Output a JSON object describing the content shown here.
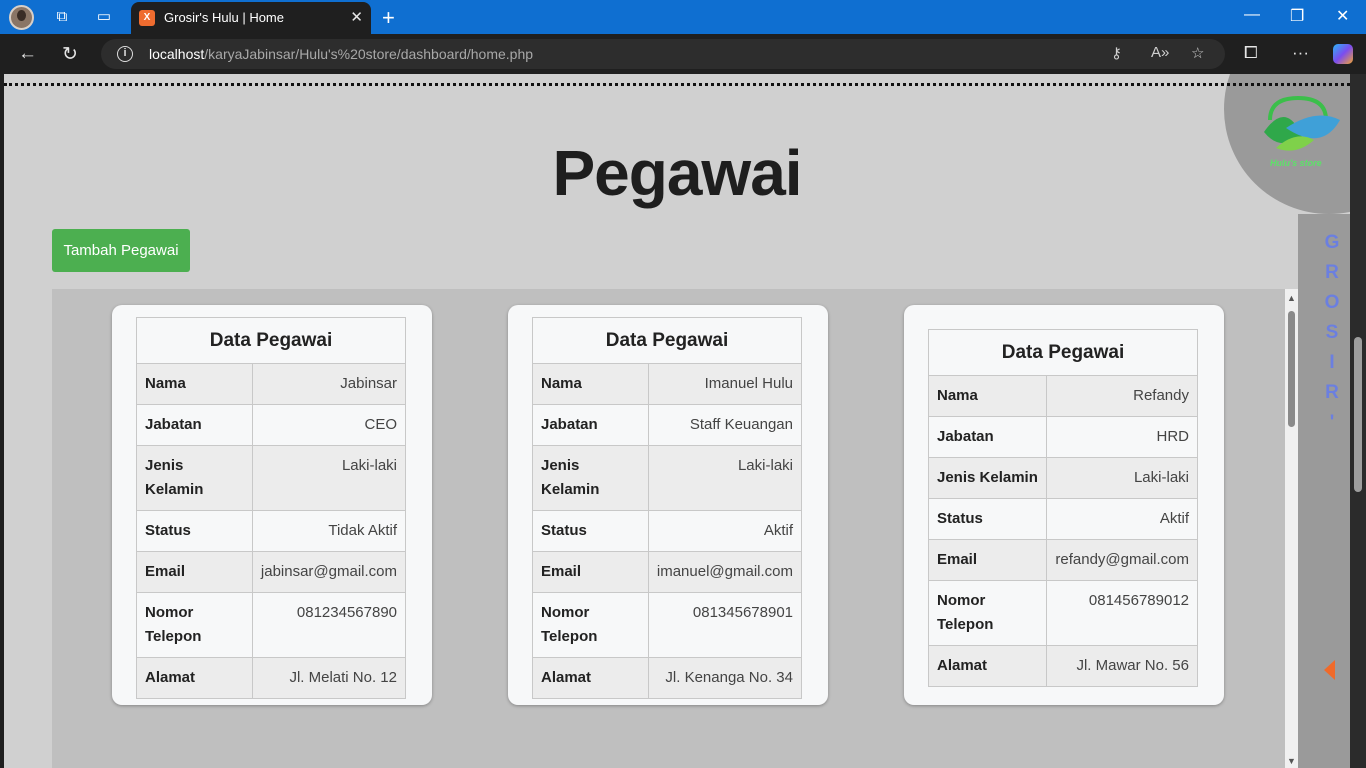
{
  "browser": {
    "tab_title": "Grosir's Hulu | Home",
    "tab_favicon": "XAMPP",
    "url_host": "localhost",
    "url_path": "/karyaJabinsar/Hulu's%20store/dashboard/home.php"
  },
  "page": {
    "title": "Pegawai",
    "add_button": "Tambah Pegawai",
    "side_text": [
      "G",
      "R",
      "O",
      "S",
      "I",
      "R",
      "'"
    ],
    "logo_text": "Hulu's store"
  },
  "cards": [
    {
      "header": "Data Pegawai",
      "rows": [
        {
          "label": "Nama",
          "value": "Jabinsar"
        },
        {
          "label": "Jabatan",
          "value": "CEO"
        },
        {
          "label": "Jenis Kelamin",
          "value": "Laki-laki"
        },
        {
          "label": "Status",
          "value": "Tidak Aktif"
        },
        {
          "label": "Email",
          "value": "jabinsar@gmail.com"
        },
        {
          "label": "Nomor Telepon",
          "value": "081234567890"
        },
        {
          "label": "Alamat",
          "value": "Jl. Melati No. 12"
        }
      ]
    },
    {
      "header": "Data Pegawai",
      "rows": [
        {
          "label": "Nama",
          "value": "Imanuel Hulu"
        },
        {
          "label": "Jabatan",
          "value": "Staff Keuangan"
        },
        {
          "label": "Jenis Kelamin",
          "value": "Laki-laki"
        },
        {
          "label": "Status",
          "value": "Aktif"
        },
        {
          "label": "Email",
          "value": "imanuel@gmail.com"
        },
        {
          "label": "Nomor Telepon",
          "value": "081345678901"
        },
        {
          "label": "Alamat",
          "value": "Jl. Kenanga No. 34"
        }
      ]
    },
    {
      "header": "Data Pegawai",
      "rows": [
        {
          "label": "Nama",
          "value": "Refandy"
        },
        {
          "label": "Jabatan",
          "value": "HRD"
        },
        {
          "label": "Jenis Kelamin",
          "value": "Laki-laki"
        },
        {
          "label": "Status",
          "value": "Aktif"
        },
        {
          "label": "Email",
          "value": "refandy@gmail.com"
        },
        {
          "label": "Nomor Telepon",
          "value": "081456789012"
        },
        {
          "label": "Alamat",
          "value": "Jl. Mawar No. 56"
        }
      ]
    }
  ],
  "colors": {
    "add_button": "#4caf50",
    "side_text": "#6b7fe0",
    "accent_arrow": "#f06a2a"
  }
}
